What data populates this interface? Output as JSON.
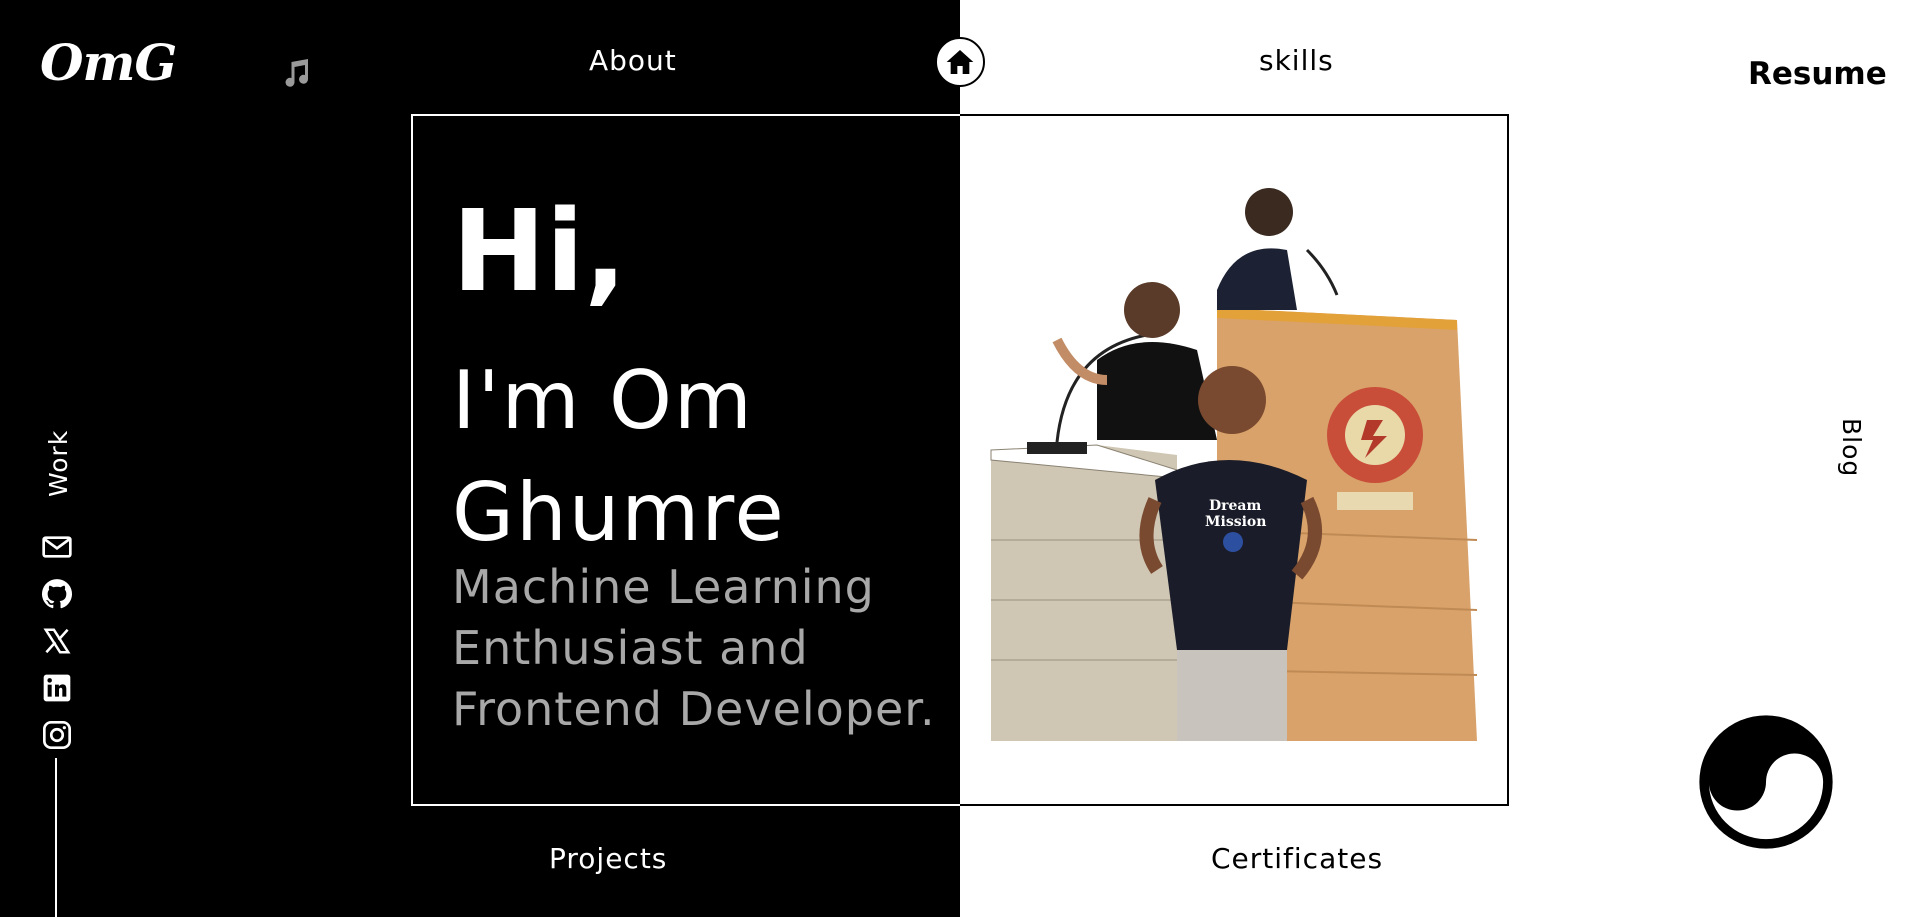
{
  "brand": {
    "logo": "OmG"
  },
  "nav": {
    "about": "About",
    "skills": "skills",
    "resume": "Resume",
    "projects": "Projects",
    "certificates": "Certificates",
    "work": "Work",
    "blog": "Blog"
  },
  "hero": {
    "greeting": "Hi,",
    "name_line1": "I'm Om",
    "name_line2": "Ghumre",
    "tagline_line1": "Machine Learning",
    "tagline_line2": "Enthusiast and",
    "tagline_line3": "Frontend Developer."
  },
  "icons": {
    "music": "music-icon",
    "home": "home-icon",
    "email": "mail-icon",
    "github": "github-icon",
    "x": "x-twitter-icon",
    "linkedin": "linkedin-icon",
    "instagram": "instagram-icon",
    "theme": "yin-yang-icon"
  },
  "colors": {
    "dark_bg": "#000000",
    "light_bg": "#ffffff",
    "tagline": "#a8a8a8",
    "muted_icon": "#9a9a9a"
  }
}
